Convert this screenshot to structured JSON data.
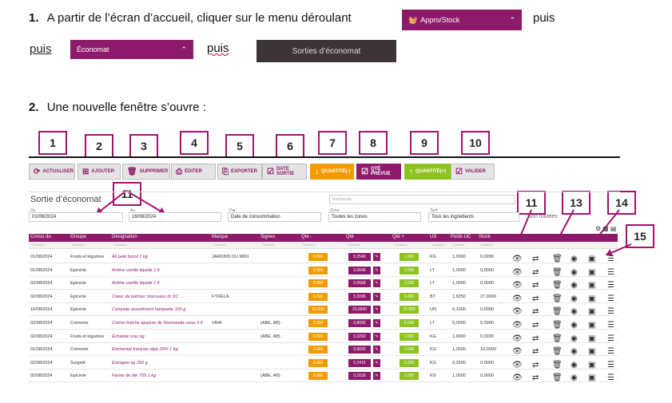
{
  "step1": {
    "num": "1.",
    "text": "A partir de l’écran d’accueil, cliquer sur le menu déroulant",
    "after": "puis"
  },
  "menu_appro": {
    "label": "Appro/Stock"
  },
  "step1b": {
    "puis1": "puis",
    "puis2": "puis"
  },
  "menu_economat": {
    "label": "Économat"
  },
  "menu_sorties": {
    "label": "Sorties d’économat"
  },
  "step2": {
    "num": "2.",
    "text": "Une nouvelle fenêtre s’ouvre :"
  },
  "callouts": [
    "1",
    "2",
    "3",
    "4",
    "5",
    "6",
    "7",
    "8",
    "9",
    "10",
    "11",
    "11",
    "13",
    "14",
    "15"
  ],
  "toolbar": [
    {
      "label": "ACTUALISER",
      "icon": "refresh-icon",
      "glyph": "⟳"
    },
    {
      "label": "AJOUTER",
      "icon": "add-icon",
      "glyph": "⊞"
    },
    {
      "label": "SUPPRIMER",
      "icon": "trash-icon",
      "glyph": "🗑"
    },
    {
      "label": "ÉDITER",
      "icon": "print-icon",
      "glyph": "⎙"
    },
    {
      "label": "EXPORTER",
      "icon": "export-icon",
      "glyph": "⎘"
    },
    {
      "label": "DATE SORTIE",
      "icon": "checkbox-icon",
      "glyph": "☑"
    },
    {
      "label": "QUANTITÉ(-)",
      "icon": "arrow-down-icon",
      "glyph": "↓"
    },
    {
      "label": "QTÉ PRÉVUE",
      "icon": "checkbox-icon",
      "glyph": "☑"
    },
    {
      "label": "QUANTITÉ(+)",
      "icon": "arrow-up-icon",
      "glyph": "↑"
    },
    {
      "label": "VALIDER",
      "icon": "validate-icon",
      "glyph": "☑"
    }
  ],
  "screen": {
    "title": "Sortie d’économat",
    "search_placeholder": "Recherche",
    "filters": {
      "du_label": "Du",
      "du_value": "01/08/2024",
      "au_label": "Au",
      "au_value": "16/08/2024",
      "par_label": "Par",
      "par_value": "Date de consommation",
      "zone_label": "Zone",
      "zone_value": "Toutes les zones",
      "tarif_label": "Tarif",
      "tarif_value": "Tous les ingrédients",
      "non_traitees": "Non traitées"
    }
  },
  "table": {
    "headers": [
      "Conso du",
      "Groupe",
      "Désignation",
      "Marque",
      "Signes",
      "Qté -",
      "Qté",
      "Qté +",
      "US",
      "Poids UC",
      "Stock"
    ],
    "filter_placeholder": "Contient...",
    "rows": [
      {
        "date": "01/08/2024",
        "groupe": "Fruits et légumes",
        "designation": "Ail pelé bocal 1 kg",
        "marque": "JARDINS DU MIDI",
        "signes": "",
        "qm": "0.000",
        "q": "0,2540",
        "qp": "1.000",
        "us": "KG",
        "poids": "1,0000",
        "stock": "0,0000"
      },
      {
        "date": "01/08/2024",
        "groupe": "Epicerie",
        "designation": "Arôme vanille liquide 1 lt",
        "marque": "",
        "signes": "",
        "qm": "0.000",
        "q": "0,0646",
        "qp": "1.000",
        "us": "LT",
        "poids": "1,0000",
        "stock": "0,0000"
      },
      {
        "date": "02/08/2024",
        "groupe": "Epicerie",
        "designation": "Arôme vanille liquide 1 lt",
        "marque": "",
        "signes": "",
        "qm": "0.000",
        "q": "0,0568",
        "qp": "1.000",
        "us": "LT",
        "poids": "1,0000",
        "stock": "0,0000"
      },
      {
        "date": "02/08/2024",
        "groupe": "Epicerie",
        "designation": "Coeur de palmier morceaux bt 3/1",
        "marque": "FYRELA",
        "signes": "",
        "qm": "5.000",
        "q": "5,3096",
        "qp": "6.000",
        "us": "BT",
        "poids": "1,8250",
        "stock": "27,0000"
      },
      {
        "date": "16/08/2024",
        "groupe": "Epicerie",
        "designation": "Compote assortiment barquette 100 g",
        "marque": "",
        "signes": "",
        "qm": "10.000",
        "q": "20,0000",
        "qp": "21.000",
        "us": "UN",
        "poids": "0,1000",
        "stock": "0,0000"
      },
      {
        "date": "02/08/2024",
        "groupe": "Crèmerie",
        "designation": "Crème fraîche épaisse de Normandie seau 5 lt",
        "marque": "VRAI",
        "signes": "(ABE, AB)",
        "qm": "0.000",
        "q": "0,8090",
        "qp": "5.000",
        "us": "LT",
        "poids": "5,0000",
        "stock": "5,0000"
      },
      {
        "date": "02/08/2024",
        "groupe": "Fruits et légumes",
        "designation": "Echalote vrac kg",
        "marque": "",
        "signes": "(ABE, AB)",
        "qm": "0.000",
        "q": "0,3260",
        "qp": "1.000",
        "us": "KG",
        "poids": "1,0000",
        "stock": "0,0000"
      },
      {
        "date": "01/08/2024",
        "groupe": "Crèmerie",
        "designation": "Emmental français râpé 29% 1 kg",
        "marque": "",
        "signes": "",
        "qm": "0.000",
        "q": "0,9690",
        "qp": "1.000",
        "us": "KG",
        "poids": "1,0000",
        "stock": "10,0000"
      },
      {
        "date": "02/08/2024",
        "groupe": "Surgelé",
        "designation": "Estragon sg 250 g",
        "marque": "",
        "signes": "",
        "qm": "0.000",
        "q": "0,2415",
        "qp": "0.250",
        "us": "KG",
        "poids": "0,2500",
        "stock": "0,0000"
      },
      {
        "date": "02/08/2024",
        "groupe": "Epicerie",
        "designation": "Farine de blé T55 1 kg",
        "marque": "",
        "signes": "(ABE, AB)",
        "qm": "0.000",
        "q": "0,1630",
        "qp": "1.000",
        "us": "KG",
        "poids": "1,0000",
        "stock": "0,0000"
      }
    ]
  },
  "colors": {
    "accent": "#8e1a6b",
    "orange": "#f29b00",
    "green": "#8dc21f",
    "callout": "#a3126f"
  }
}
